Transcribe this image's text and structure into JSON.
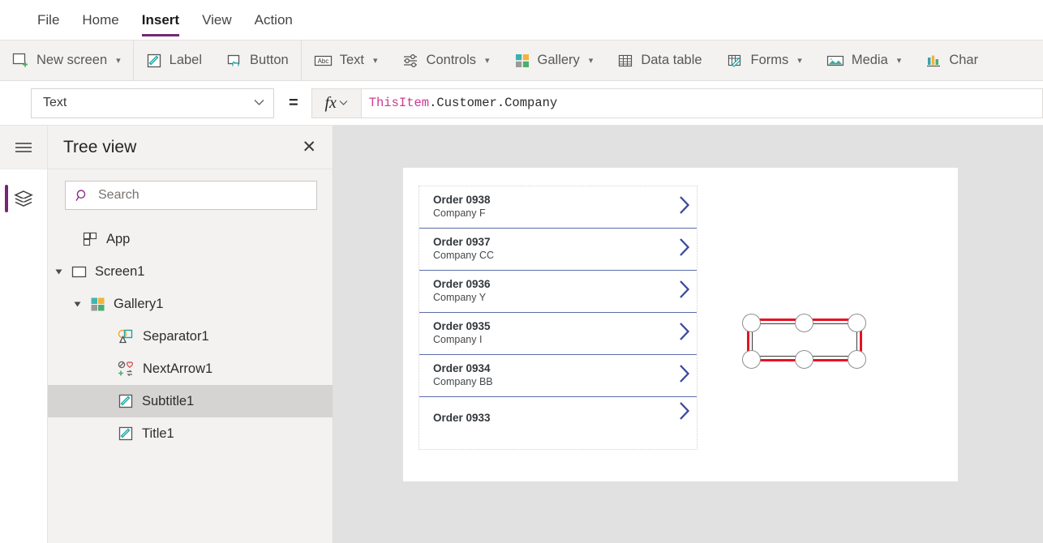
{
  "menubar": {
    "items": [
      {
        "label": "File",
        "active": false
      },
      {
        "label": "Home",
        "active": false
      },
      {
        "label": "Insert",
        "active": true
      },
      {
        "label": "View",
        "active": false
      },
      {
        "label": "Action",
        "active": false
      }
    ]
  },
  "ribbon": {
    "groups": [
      {
        "buttons": [
          {
            "label": "New screen",
            "icon": "new-screen-icon",
            "caret": true
          }
        ]
      },
      {
        "buttons": [
          {
            "label": "Label",
            "icon": "label-icon",
            "caret": false
          },
          {
            "label": "Button",
            "icon": "button-icon",
            "caret": false
          }
        ]
      },
      {
        "buttons": [
          {
            "label": "Text",
            "icon": "text-icon",
            "caret": true
          },
          {
            "label": "Controls",
            "icon": "controls-icon",
            "caret": true
          },
          {
            "label": "Gallery",
            "icon": "gallery-icon",
            "caret": true
          },
          {
            "label": "Data table",
            "icon": "data-table-icon",
            "caret": false
          },
          {
            "label": "Forms",
            "icon": "forms-icon",
            "caret": true
          },
          {
            "label": "Media",
            "icon": "media-icon",
            "caret": true
          },
          {
            "label": "Char",
            "icon": "charts-icon",
            "caret": false
          }
        ]
      }
    ]
  },
  "formula_bar": {
    "property_selected": "Text",
    "equals": "=",
    "fx_label": "fx",
    "formula_token_highlight": "ThisItem",
    "formula_token_rest": ".Customer.Company",
    "formula_full": "ThisItem.Customer.Company",
    "highlight_color": "#cc3b8f"
  },
  "left_rail": {
    "hamburger": "hamburger-icon",
    "active_tool": "tree-view-icon",
    "accent_color": "#742774"
  },
  "tree_view": {
    "title": "Tree view",
    "close": "✕",
    "search": {
      "placeholder": "Search",
      "value": ""
    },
    "nodes": [
      {
        "label": "App",
        "indent": 0,
        "twisty": "none",
        "icon": "app-icon",
        "selected": false
      },
      {
        "label": "Screen1",
        "indent": 0,
        "twisty": "expanded",
        "icon": "screen-icon",
        "selected": false
      },
      {
        "label": "Gallery1",
        "indent": 1,
        "twisty": "expanded",
        "icon": "gallery-icon",
        "selected": false
      },
      {
        "label": "Separator1",
        "indent": 2,
        "twisty": "none",
        "icon": "shapes-icon",
        "selected": false
      },
      {
        "label": "NextArrow1",
        "indent": 2,
        "twisty": "none",
        "icon": "icons-icon",
        "selected": false
      },
      {
        "label": "Subtitle1",
        "indent": 2,
        "twisty": "none",
        "icon": "label-icon",
        "selected": true
      },
      {
        "label": "Title1",
        "indent": 2,
        "twisty": "none",
        "icon": "label-icon",
        "selected": false
      }
    ]
  },
  "canvas": {
    "background_color": "#e1e1e1",
    "screen_color": "#ffffff",
    "selection": {
      "color": "#e81123",
      "handle_count": 6,
      "target_control": "Subtitle1"
    },
    "gallery_items": [
      {
        "title": "Order 0938",
        "subtitle": "Company F",
        "chevron": "chevron-right-icon"
      },
      {
        "title": "Order 0937",
        "subtitle": "Company CC",
        "chevron": "chevron-right-icon"
      },
      {
        "title": "Order 0936",
        "subtitle": "Company Y",
        "chevron": "chevron-right-icon"
      },
      {
        "title": "Order 0935",
        "subtitle": "Company I",
        "chevron": "chevron-right-icon"
      },
      {
        "title": "Order 0934",
        "subtitle": "Company BB",
        "chevron": "chevron-right-icon"
      },
      {
        "title": "Order 0933",
        "subtitle": "",
        "chevron": "chevron-right-icon"
      }
    ]
  }
}
